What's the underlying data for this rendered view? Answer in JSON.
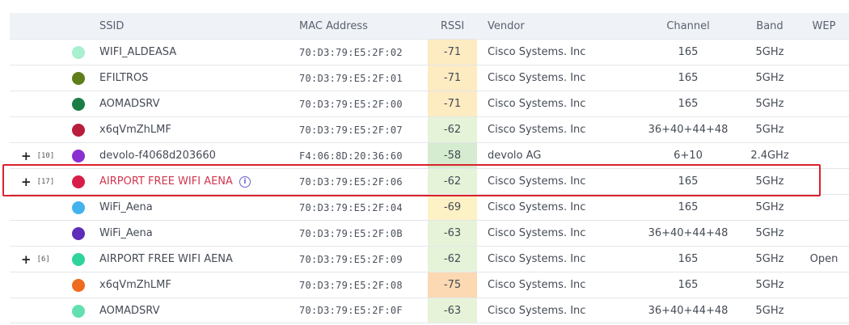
{
  "headers": {
    "ssid": "SSID",
    "mac": "MAC Address",
    "rssi": "RSSI",
    "vendor": "Vendor",
    "channel": "Channel",
    "band": "Band",
    "wep": "WEP"
  },
  "rows": [
    {
      "expand": "",
      "count": "",
      "dot": "#a8f0cf",
      "ssid": "WIFI_ALDEASA",
      "mac": "70:D3:79:E5:2F:02",
      "rssi": "-71",
      "rssi_bg": "#fdebc2",
      "vendor": "Cisco Systems. Inc",
      "channel": "165",
      "band": "5GHz",
      "wep": "",
      "info": ""
    },
    {
      "expand": "",
      "count": "",
      "dot": "#5e7e1a",
      "ssid": "EFILTROS",
      "mac": "70:D3:79:E5:2F:01",
      "rssi": "-71",
      "rssi_bg": "#fdebc2",
      "vendor": "Cisco Systems. Inc",
      "channel": "165",
      "band": "5GHz",
      "wep": "",
      "info": ""
    },
    {
      "expand": "",
      "count": "",
      "dot": "#1a7d46",
      "ssid": "AOMADSRV",
      "mac": "70:D3:79:E5:2F:00",
      "rssi": "-71",
      "rssi_bg": "#fdebc2",
      "vendor": "Cisco Systems. Inc",
      "channel": "165",
      "band": "5GHz",
      "wep": "",
      "info": ""
    },
    {
      "expand": "",
      "count": "",
      "dot": "#b81e3c",
      "ssid": "x6qVmZhLMF",
      "mac": "70:D3:79:E5:2F:07",
      "rssi": "-62",
      "rssi_bg": "#e5f3d9",
      "vendor": "Cisco Systems. Inc",
      "channel": "36+40+44+48",
      "band": "5GHz",
      "wep": "",
      "info": ""
    },
    {
      "expand": "+",
      "count": "[10]",
      "dot": "#8a2fd0",
      "ssid": "devolo-f4068d203660",
      "mac": "F4:06:8D:20:36:60",
      "rssi": "-58",
      "rssi_bg": "#d6ecd0",
      "vendor": "devolo AG",
      "channel": "6+10",
      "band": "2.4GHz",
      "wep": "",
      "info": ""
    },
    {
      "expand": "+",
      "count": "[17]",
      "dot": "#d81e48",
      "ssid": "AIRPORT FREE WIFI AENA",
      "mac": "70:D3:79:E5:2F:06",
      "rssi": "-62",
      "rssi_bg": "#e5f3d9",
      "vendor": "Cisco Systems. Inc",
      "channel": "165",
      "band": "5GHz",
      "wep": "",
      "info": "i",
      "highlight": true
    },
    {
      "expand": "",
      "count": "",
      "dot": "#43b3ee",
      "ssid": "WiFi_Aena",
      "mac": "70:D3:79:E5:2F:04",
      "rssi": "-69",
      "rssi_bg": "#fdf1c6",
      "vendor": "Cisco Systems. Inc",
      "channel": "165",
      "band": "5GHz",
      "wep": "",
      "info": ""
    },
    {
      "expand": "",
      "count": "",
      "dot": "#5e2db8",
      "ssid": "WiFi_Aena",
      "mac": "70:D3:79:E5:2F:0B",
      "rssi": "-63",
      "rssi_bg": "#e7f3d8",
      "vendor": "Cisco Systems. Inc",
      "channel": "36+40+44+48",
      "band": "5GHz",
      "wep": "",
      "info": ""
    },
    {
      "expand": "+",
      "count": "[6]",
      "dot": "#2ed49b",
      "ssid": "AIRPORT FREE WIFI AENA",
      "mac": "70:D3:79:E5:2F:09",
      "rssi": "-62",
      "rssi_bg": "#e5f3d9",
      "vendor": "Cisco Systems. Inc",
      "channel": "165",
      "band": "5GHz",
      "wep": "Open",
      "info": ""
    },
    {
      "expand": "",
      "count": "",
      "dot": "#ee6a1e",
      "ssid": "x6qVmZhLMF",
      "mac": "70:D3:79:E5:2F:08",
      "rssi": "-75",
      "rssi_bg": "#fcd9b2",
      "vendor": "Cisco Systems. Inc",
      "channel": "165",
      "band": "5GHz",
      "wep": "",
      "info": ""
    },
    {
      "expand": "",
      "count": "",
      "dot": "#62e0b0",
      "ssid": "AOMADSRV",
      "mac": "70:D3:79:E5:2F:0F",
      "rssi": "-63",
      "rssi_bg": "#e7f3d8",
      "vendor": "Cisco Systems. Inc",
      "channel": "36+40+44+48",
      "band": "5GHz",
      "wep": "",
      "info": ""
    }
  ]
}
